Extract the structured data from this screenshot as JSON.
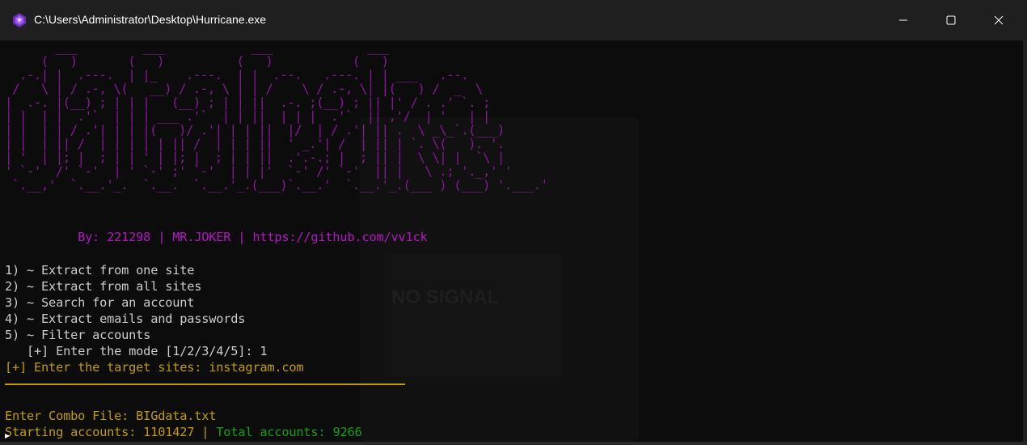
{
  "window": {
    "title": "C:\\Users\\Administrator\\Desktop\\Hurricane.exe",
    "app_icon": "purple-gem-icon",
    "controls": {
      "minimize": "minimize-icon",
      "maximize": "maximize-icon",
      "close": "close-icon"
    }
  },
  "terminal": {
    "banner_art": "       ___         ___            ___             ___\n     (   )       (   )          (   )           (   )\n  .-.| |  .---.  | |_    .---.  | |  .--.   .---. | | ___   .--.\n /   \\ | / .-, \\(   __) / .-, \\ | | /    \\ / .-, \\| |(   ) /  _  \\\n|  .-. |(__) ; | | |   (__) ; | | ||  .-. ;(__) ; || |' / . .' `. ;\n| |  | |  .'`  | | | ___ .'`  | | ||  | | |  .'`  || ,'/  | '   | |\n| |  | | / .'| | | |(   )/ .'| | | ||  |/  | / .'| || .  \\ _\\_`.(___)\n| |  | || /  | | | | | || /  | | | ||  ' _.'| /  | || | `. \\(   ). '.\n| '  | |; |  ; | | ' | |; |  ; | | ||  .'.-.; |  ; || |  \\ \\| |  `\\ |\n' `-'  /' `-'  | ' `-' ;' `-'  | | |'  `-' /' `-'  || |   \\ .; '._,' '\n `.__,'  `.__.'_.  `.__.  `.__.'_.(___)`.__.'  `.__.'_.(___ ) (___) '.___.'",
    "credit": "          By: 221298 | MR.JOKER | https://github.com/vv1ck",
    "menu": [
      "1) ~ Extract from one site",
      "2) ~ Extract from all sites",
      "3) ~ Search for an account",
      "4) ~ Extract emails and passwords",
      "5) ~ Filter accounts"
    ],
    "mode_prompt": "   [+] Enter the mode [1/2/3/4/5]: 1",
    "target_prompt": "[+] Enter the target sites: instagram.com",
    "combo_prompt": "Enter Combo File: BIGdata.txt",
    "starting_accounts": "Starting accounts: 1101427 |",
    "total_accounts": " Total accounts: 9266"
  },
  "background": {
    "ghost_text": "NO SIGNAL"
  },
  "colors": {
    "banner": "#881798",
    "credit": "#b416c4",
    "menu": "#cccccc",
    "prompt": "#c19c00",
    "total": "#13a10e",
    "titlebar": "#1f1f1f",
    "terminal_bg": "#0c0c0c"
  }
}
